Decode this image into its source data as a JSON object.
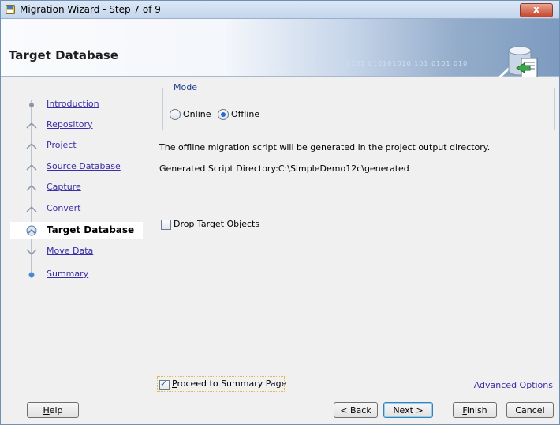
{
  "window": {
    "title": "Migration Wizard - Step 7 of 9",
    "close_label": "x"
  },
  "banner": {
    "title": "Target Database",
    "decor_digits": "0101 010101010 101 0101 010"
  },
  "nav": {
    "items": [
      {
        "label": "Introduction",
        "state": "done"
      },
      {
        "label": "Repository",
        "state": "done"
      },
      {
        "label": "Project",
        "state": "done"
      },
      {
        "label": "Source Database",
        "state": "done"
      },
      {
        "label": "Capture",
        "state": "done"
      },
      {
        "label": "Convert",
        "state": "done"
      },
      {
        "label": "Target Database",
        "state": "active"
      },
      {
        "label": "Move Data",
        "state": "pending"
      },
      {
        "label": "Summary",
        "state": "pending"
      }
    ]
  },
  "mode": {
    "legend": "Mode",
    "options": [
      {
        "label": "Online",
        "selected": false
      },
      {
        "label": "Offline",
        "selected": true
      }
    ]
  },
  "message": "The offline migration script will be generated in the project output directory.",
  "script_dir": "Generated Script Directory:C:\\SimpleDemo12c\\generated",
  "drop_target": {
    "label": "Drop Target Objects",
    "checked": false
  },
  "proceed": {
    "label": "Proceed to Summary Page",
    "checked": true
  },
  "advanced_options": "Advanced Options",
  "buttons": {
    "help": "Help",
    "back": "< Back",
    "next": "Next >",
    "finish": "Finish",
    "cancel": "Cancel"
  },
  "colors": {
    "link": "#3b2ea8",
    "banner_accent": "#7d9bc0",
    "close": "#c8452c"
  },
  "icons": {
    "app": "migration-wizard-icon",
    "banner": "database-migration-icon"
  }
}
